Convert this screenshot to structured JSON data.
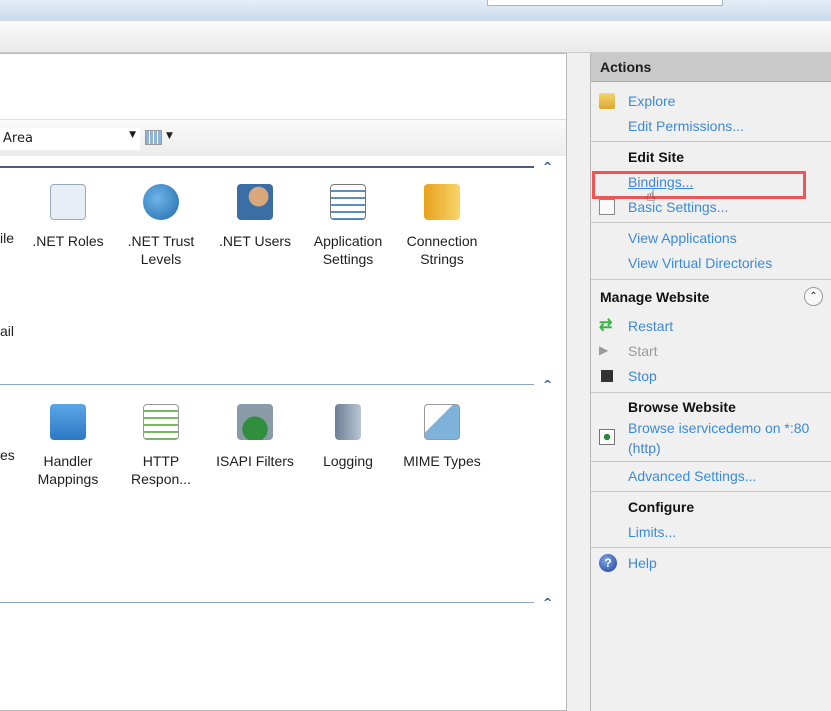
{
  "filter": {
    "group_by": "Area"
  },
  "features": {
    "row1_cut": "ile",
    "row1b_cut": "ail",
    "row1": [
      ".NET Roles",
      ".NET Trust Levels",
      ".NET Users",
      "Application Settings",
      "Connection Strings"
    ],
    "row2_cut": "es",
    "row2": [
      "Handler Mappings",
      "HTTP Respon...",
      "ISAPI Filters",
      "Logging",
      "MIME Types"
    ]
  },
  "actions": {
    "title": "Actions",
    "explore": "Explore",
    "edit_permissions": "Edit Permissions...",
    "edit_site": "Edit Site",
    "bindings": "Bindings...",
    "basic_settings": "Basic Settings...",
    "view_applications": "View Applications",
    "view_virtual_directories": "View Virtual Directories",
    "manage_website": "Manage Website",
    "restart": "Restart",
    "start": "Start",
    "stop": "Stop",
    "browse_website": "Browse Website",
    "browse_link": "Browse iservicedemo on *:80",
    "browse_link2": "(http)",
    "advanced_settings": "Advanced Settings...",
    "configure": "Configure",
    "limits": "Limits...",
    "help": "Help"
  },
  "colors": {
    "link": "#3b8ad9",
    "highlight": "#f05454"
  }
}
